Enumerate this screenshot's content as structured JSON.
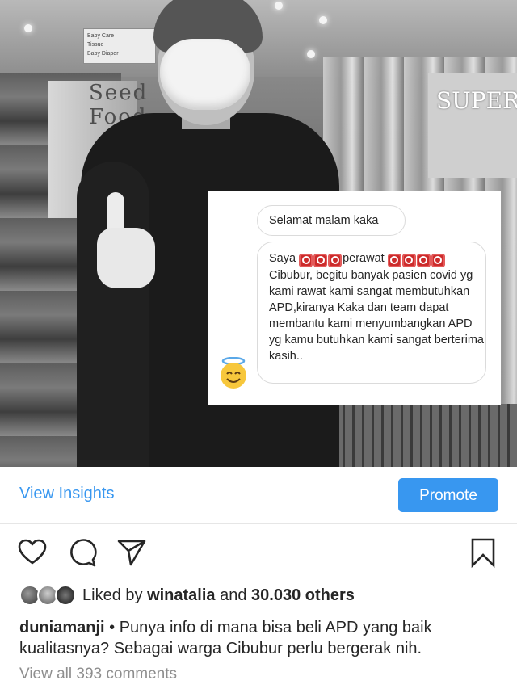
{
  "photo": {
    "store_sign": "Seed Food",
    "super_sign": "SUPER",
    "hanging_sign_lines": [
      "Baby Care",
      "Tissue",
      "Baby Diaper"
    ]
  },
  "chat": {
    "greeting": "Selamat malam kaka",
    "message_part1": "Saya ",
    "message_part2": "perawat ",
    "message_part3": "Cibubur, begitu banyak pasien covid yg kami rawat kami sangat membutuhkan APD,kiranya Kaka dan team dapat membantu kami menyumbangkan APD yg kamu butuhkan kami sangat berterima kasih..",
    "censor_group1_count": 3,
    "censor_group2_count": 4,
    "avatar_icon": "smiling-face-with-halo-emoji"
  },
  "insights": {
    "view_insights_label": "View Insights",
    "promote_label": "Promote"
  },
  "actions": {
    "icons": [
      "heart-icon",
      "comment-icon",
      "share-icon",
      "bookmark-icon"
    ]
  },
  "likes": {
    "prefix": "Liked by ",
    "user": "winatalia",
    "middle": " and ",
    "count": "30.030 others"
  },
  "caption": {
    "username": "duniamanji",
    "separator": " • ",
    "text": "Punya info di mana bisa beli APD yang baik kualitasnya? Sebagai warga Cibubur perlu bergerak nih."
  },
  "comments": {
    "view_all_label": "View all 393 comments"
  },
  "colors": {
    "link_blue": "#3897f0",
    "text_dark": "#262626",
    "text_muted": "#8e8e8e",
    "censor_red": "#cc2b2b"
  }
}
